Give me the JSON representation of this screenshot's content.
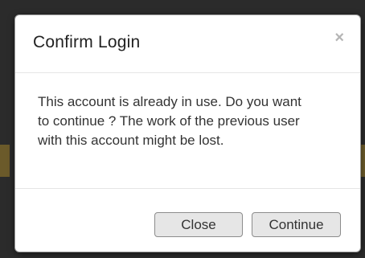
{
  "dialog": {
    "title": "Confirm Login",
    "close_glyph": "×",
    "message": "This account is already in use. Do you want to continue ? The work of the previous user with this account might be lost.",
    "buttons": {
      "close_label": "Close",
      "continue_label": "Continue"
    }
  },
  "colors": {
    "dialog_background": "#ffffff",
    "button_background": "#e6e6e6",
    "button_border": "#8c8c8c",
    "close_icon": "#b5b5b5"
  },
  "icons": {
    "close": "close-icon"
  }
}
